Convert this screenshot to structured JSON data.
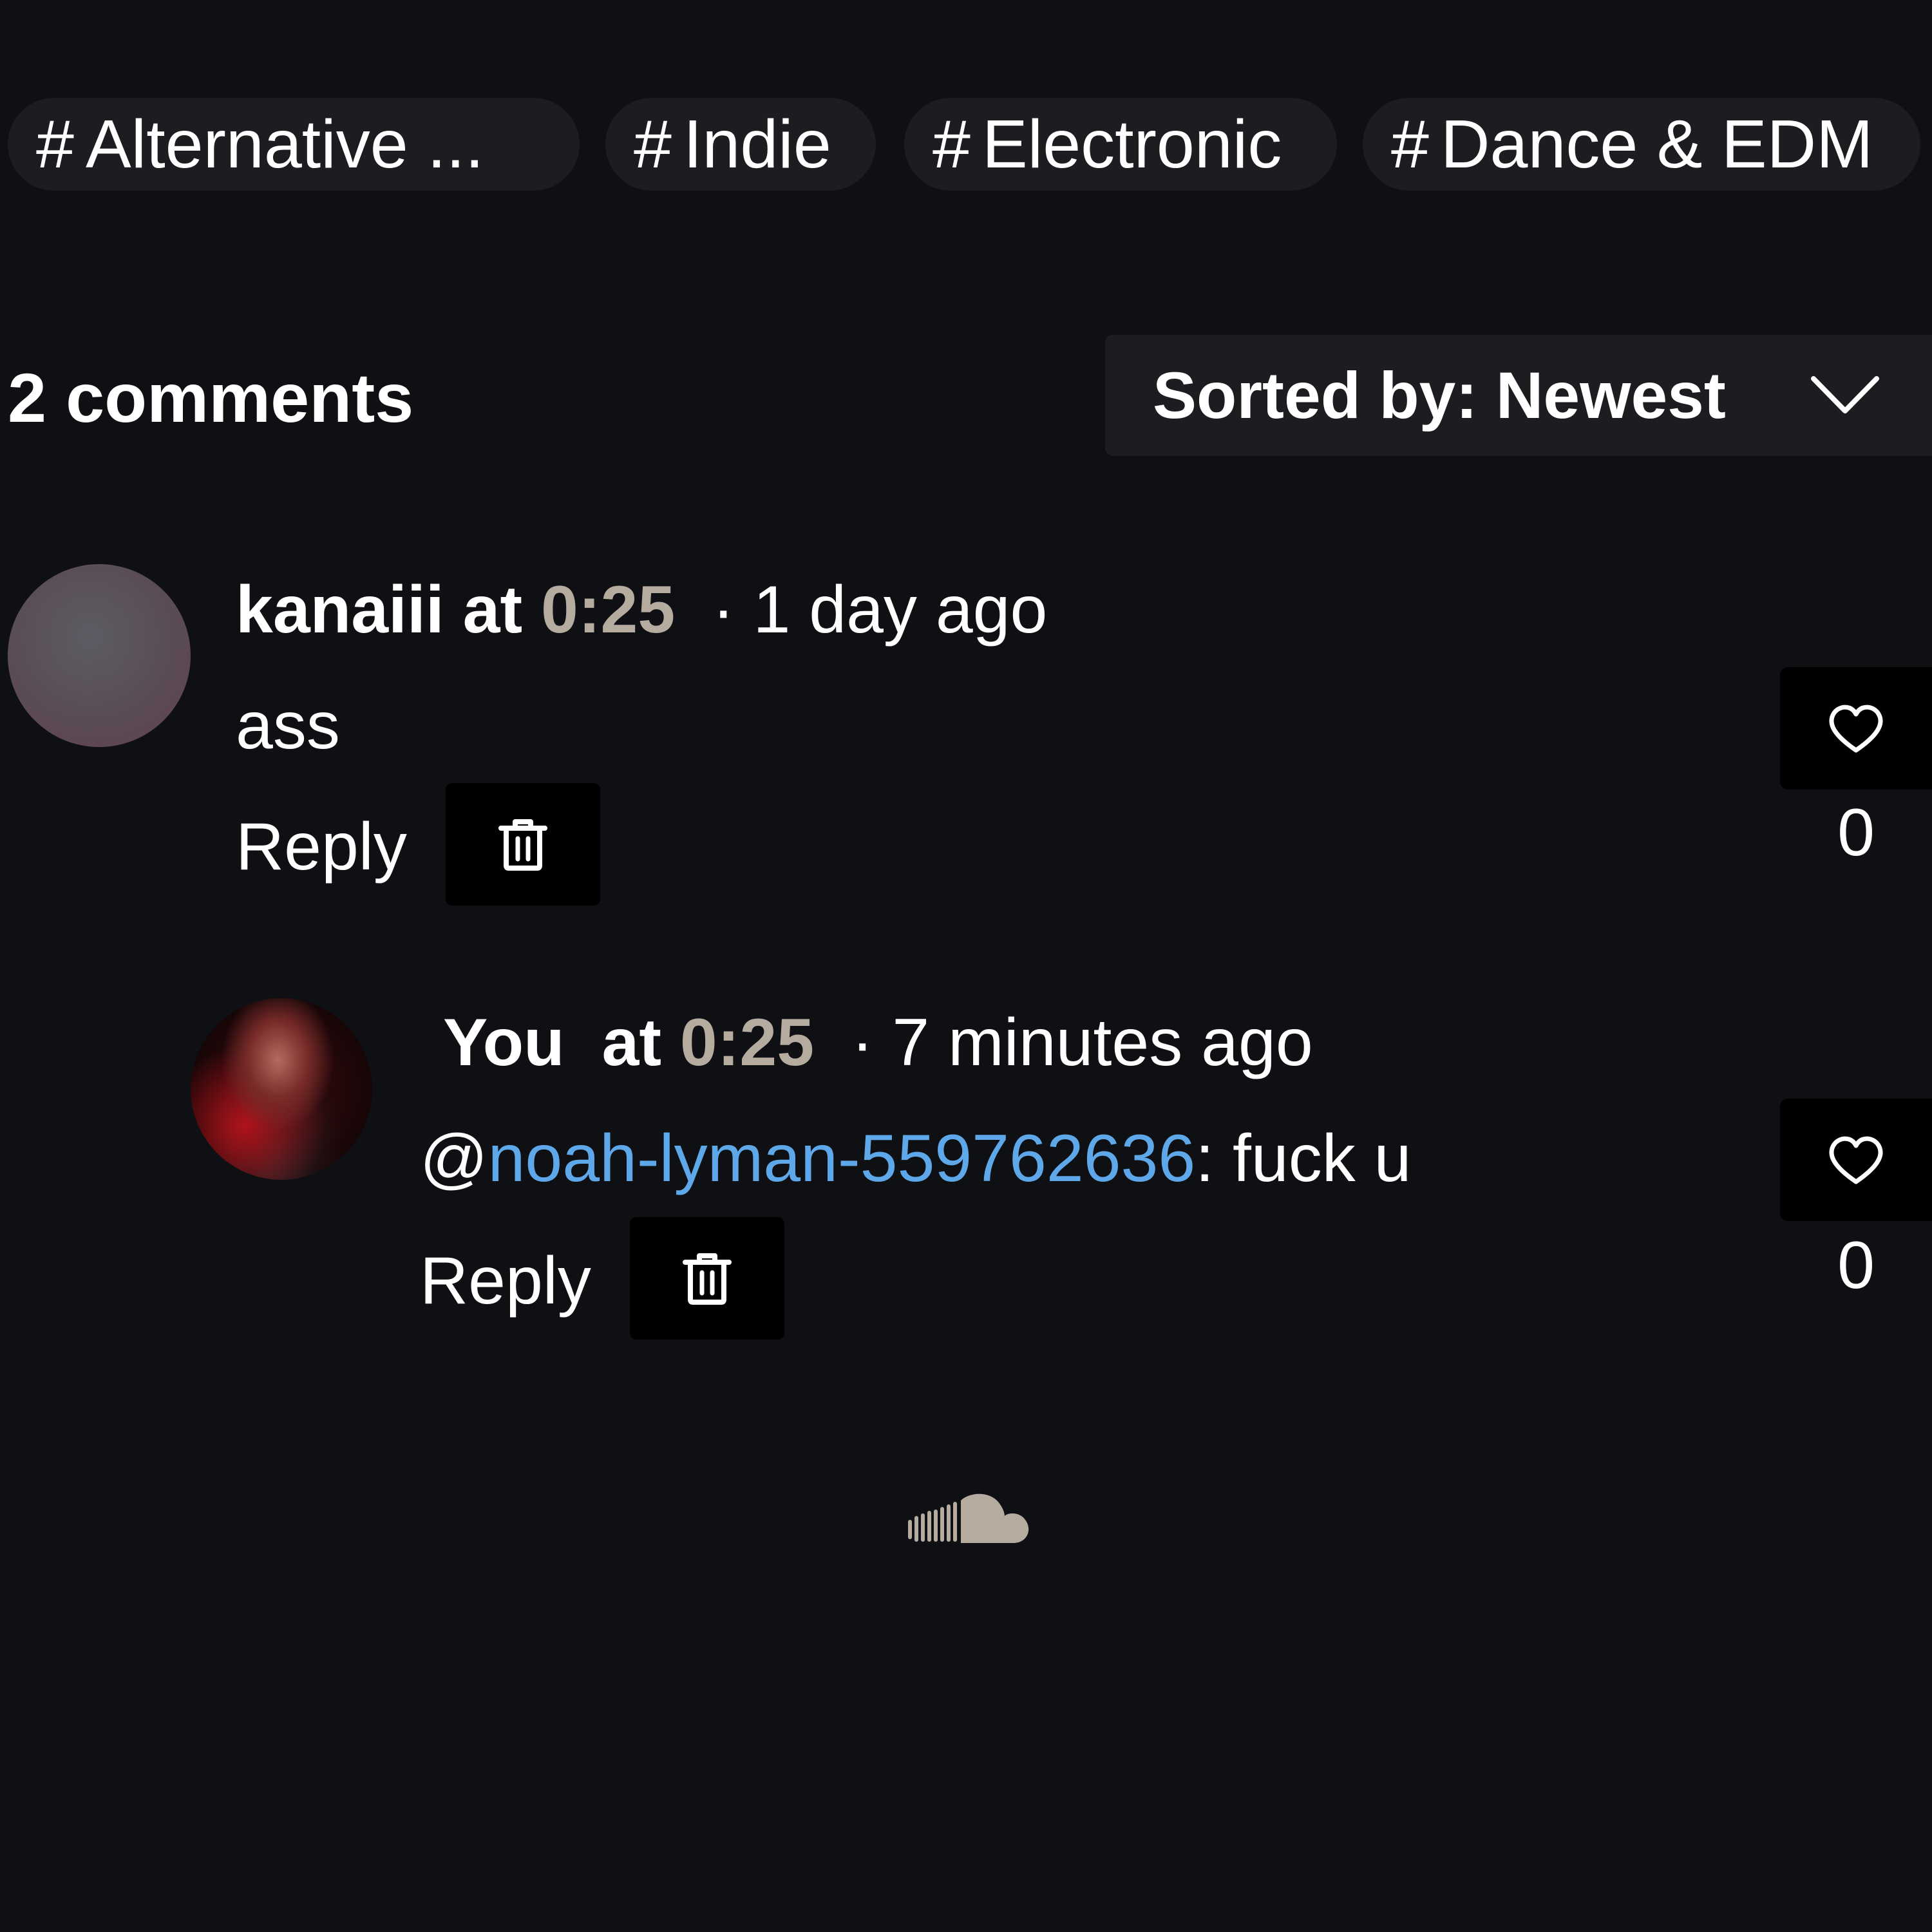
{
  "tags": [
    {
      "hash": "#",
      "label": "Alternative ..."
    },
    {
      "hash": "#",
      "label": "Indie"
    },
    {
      "hash": "#",
      "label": "Electronic"
    },
    {
      "hash": "#",
      "label": "Dance & EDM"
    }
  ],
  "comments_header": {
    "count_label": "2 comments",
    "sort_label": "Sorted by: Newest"
  },
  "comments": [
    {
      "user": "kanaiii",
      "at_label": "at",
      "timestamp": "0:25",
      "ago": "· 1 day ago",
      "text": "ass",
      "reply_label": "Reply",
      "like_count": "0"
    },
    {
      "user": "You",
      "at_label": "at",
      "timestamp": "0:25",
      "ago": "· 7 minutes ago",
      "mention_prefix": "@",
      "mention": "noah-lyman-559762636",
      "text": ": fuck u",
      "reply_label": "Reply",
      "like_count": "0"
    }
  ],
  "icons": {
    "sort": "chevron-down-icon",
    "delete": "trash-icon",
    "like": "heart-icon",
    "footer": "soundcloud-logo-icon"
  },
  "colors": {
    "background": "#0f1013",
    "chip": "#1b1d21",
    "timestamp": "#b5ab9f",
    "mention": "#5ea8ea",
    "logo": "#b5ab9f"
  }
}
